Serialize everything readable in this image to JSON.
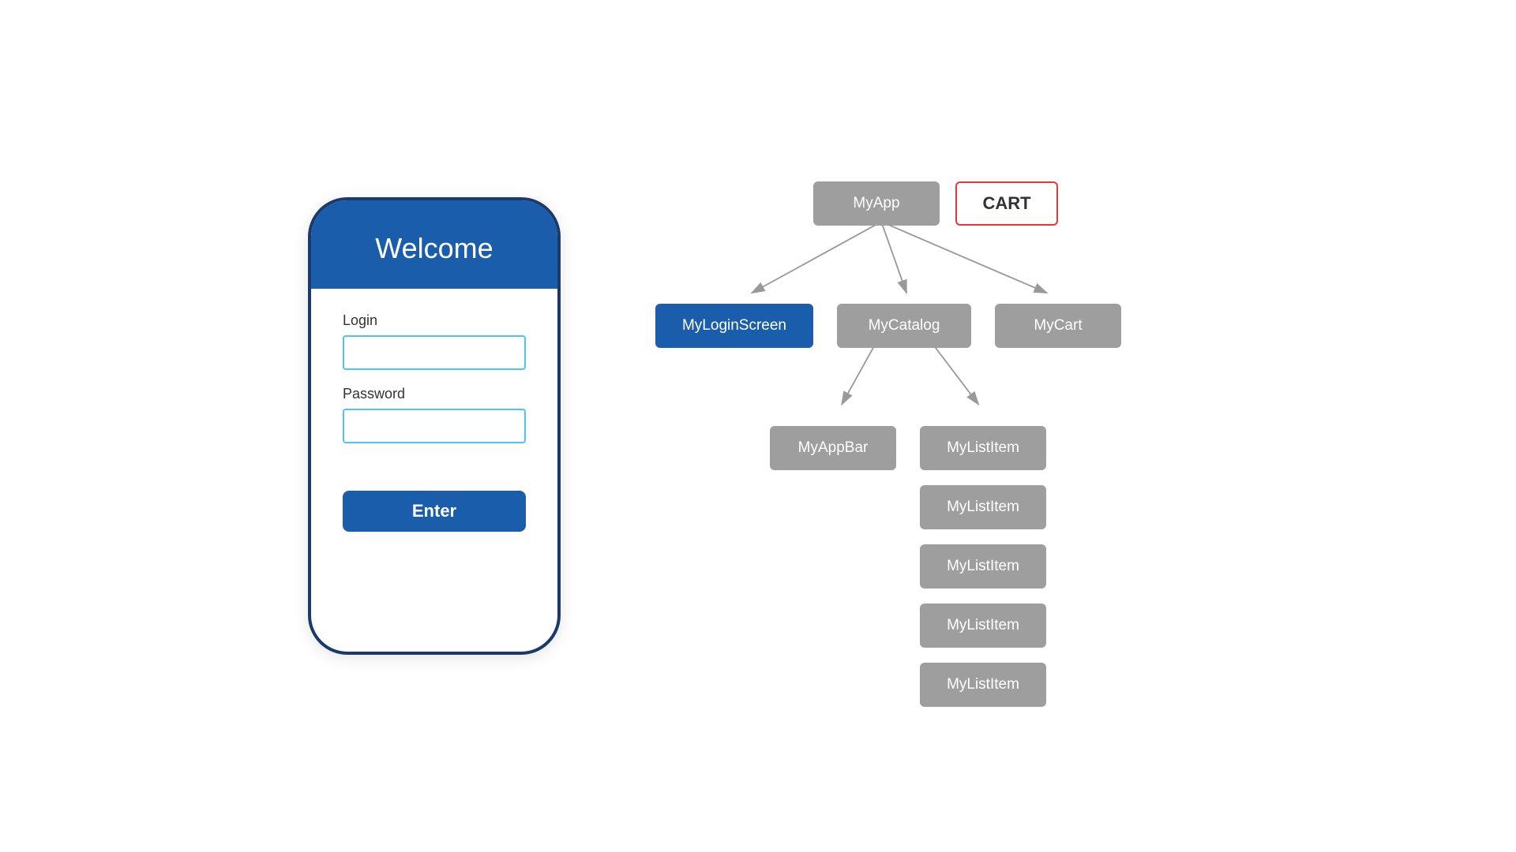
{
  "phone": {
    "header_title": "Welcome",
    "login_label": "Login",
    "login_placeholder": "",
    "password_label": "Password",
    "password_placeholder": "",
    "enter_button": "Enter"
  },
  "diagram": {
    "nodes": {
      "myapp": "MyApp",
      "cart": "CART",
      "myloginscreen": "MyLoginScreen",
      "mycatalog": "MyCatalog",
      "mycart": "MyCart",
      "myappbar": "MyAppBar",
      "mylistitem_1": "MyListItem",
      "mylistitem_2": "MyListItem",
      "mylistitem_3": "MyListItem",
      "mylistitem_4": "MyListItem",
      "mylistitem_5": "MyListItem"
    }
  }
}
